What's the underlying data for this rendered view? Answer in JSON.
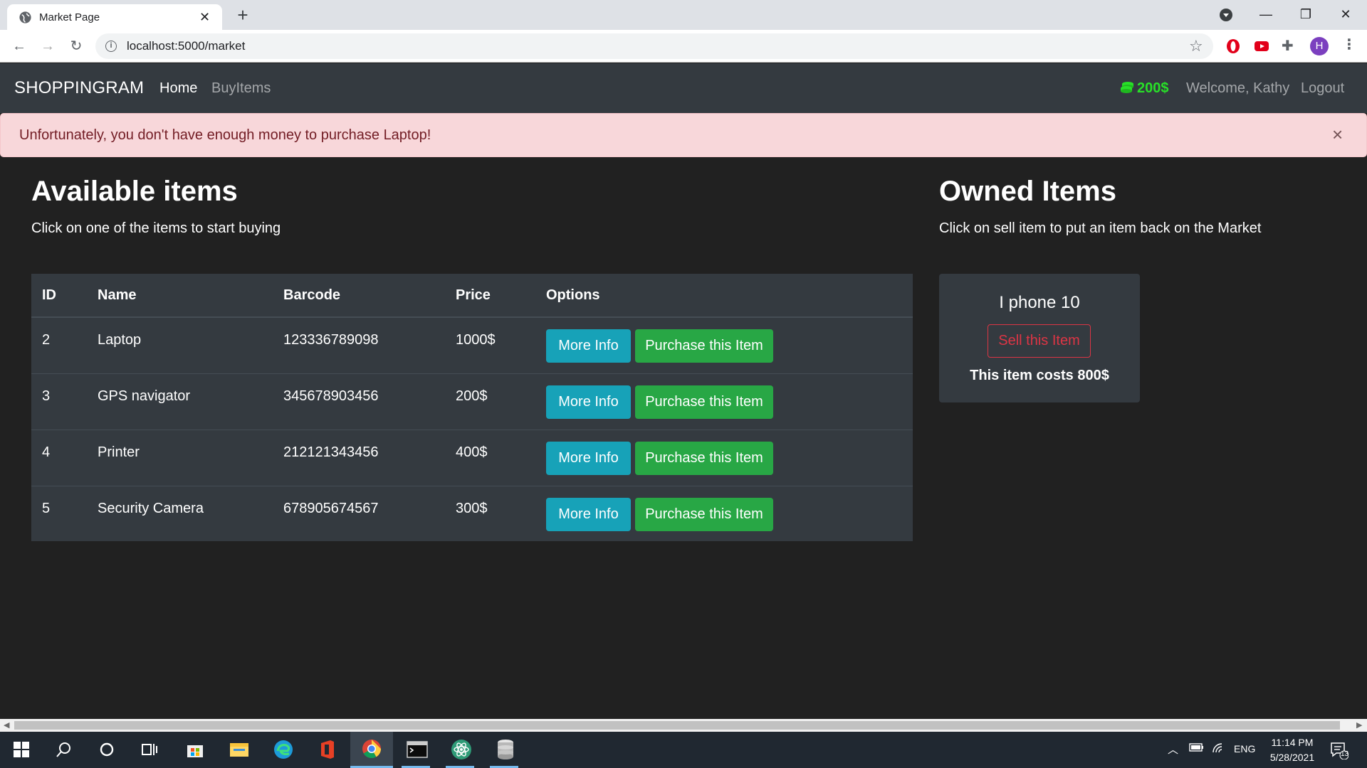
{
  "browser": {
    "tab_title": "Market Page",
    "url": "localhost:5000/market",
    "profile_initial": "H"
  },
  "navbar": {
    "brand": "SHOPPINGRAM",
    "links": [
      "Home",
      "BuyItems"
    ],
    "budget": "200$",
    "welcome": "Welcome, Kathy",
    "logout": "Logout"
  },
  "alert": {
    "message": "Unfortunately, you don't have enough money to purchase Laptop!",
    "close_symbol": "×"
  },
  "available": {
    "title": "Available items",
    "subtitle": "Click on one of the items to start buying",
    "columns": [
      "ID",
      "Name",
      "Barcode",
      "Price",
      "Options"
    ],
    "items": [
      {
        "id": "2",
        "name": "Laptop",
        "barcode": "123336789098",
        "price": "1000$"
      },
      {
        "id": "3",
        "name": "GPS navigator",
        "barcode": "345678903456",
        "price": "200$"
      },
      {
        "id": "4",
        "name": "Printer",
        "barcode": "212121343456",
        "price": "400$"
      },
      {
        "id": "5",
        "name": "Security Camera",
        "barcode": "678905674567",
        "price": "300$"
      }
    ],
    "more_info_label": "More Info",
    "purchase_label": "Purchase this Item"
  },
  "owned": {
    "title": "Owned Items",
    "subtitle": "Click on sell item to put an item back on the Market",
    "item_name": "I phone 10",
    "sell_label": "Sell this Item",
    "cost_text": "This item costs 800$"
  },
  "taskbar": {
    "language": "ENG",
    "time": "11:14 PM",
    "date": "5/28/2021",
    "notification_count": "13"
  },
  "colors": {
    "page_bg": "#212121",
    "navbar_bg": "#343a40",
    "alert_bg": "#f8d7da",
    "info": "#17a2b8",
    "success": "#28a745",
    "danger": "#dc3545",
    "budget": "#28e028"
  }
}
